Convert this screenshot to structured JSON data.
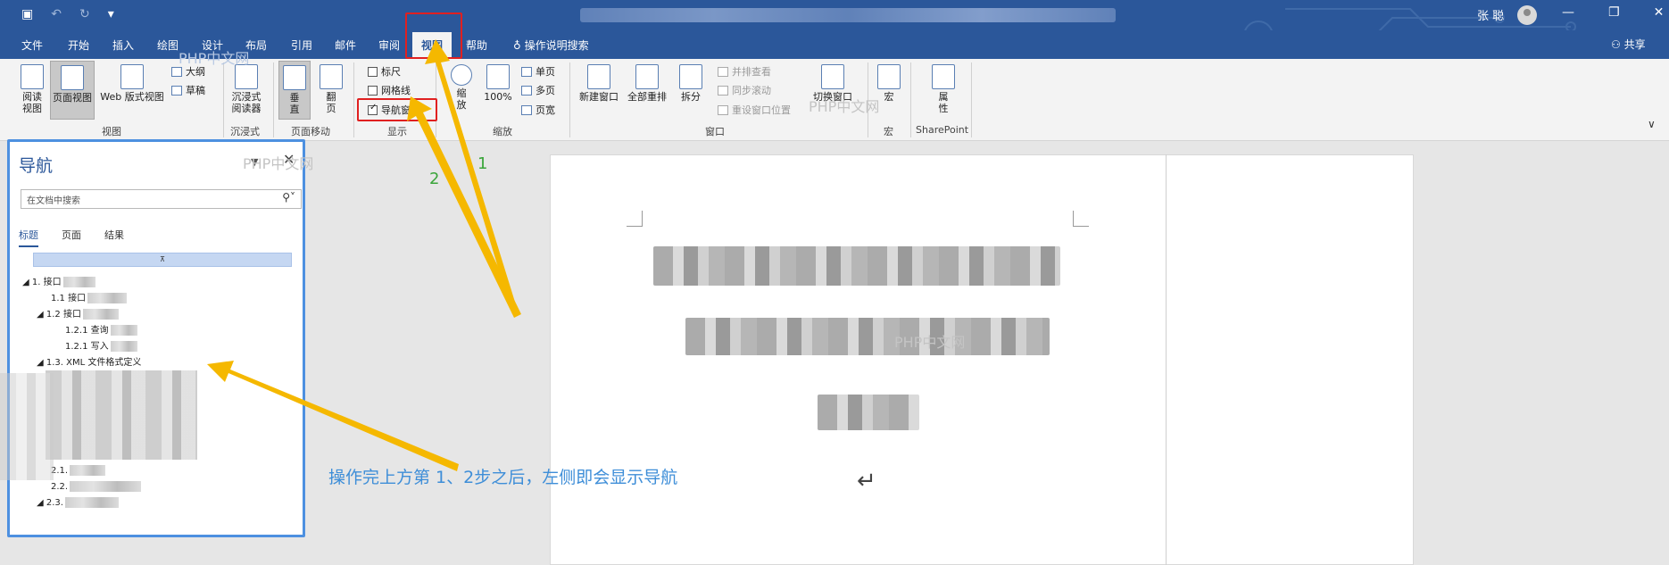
{
  "titlebar": {
    "qat_icons": [
      "save-icon",
      "undo-icon",
      "redo-icon",
      "customize-icon"
    ],
    "user_name": "张 聪",
    "window_buttons": [
      "—",
      "❐",
      "✕"
    ]
  },
  "tabs": [
    {
      "label": "文件"
    },
    {
      "label": "开始"
    },
    {
      "label": "插入"
    },
    {
      "label": "绘图"
    },
    {
      "label": "设计"
    },
    {
      "label": "布局"
    },
    {
      "label": "引用"
    },
    {
      "label": "邮件"
    },
    {
      "label": "审阅"
    },
    {
      "label": "视图"
    },
    {
      "label": "帮助"
    }
  ],
  "tell_me": "操作说明搜索",
  "share": "共享",
  "ribbon": {
    "views": {
      "read": "阅读视图",
      "print": "页面视图",
      "web": "Web 版式视图",
      "outline": "大纲",
      "draft": "草稿",
      "group": "视图"
    },
    "immersive": {
      "reader": "沉浸式阅读器",
      "group": "沉浸式"
    },
    "page_move": {
      "vertical": "垂直",
      "side": "翻页",
      "group": "页面移动"
    },
    "show": {
      "ruler": "标尺",
      "gridlines": "网格线",
      "nav_pane": "导航窗格",
      "group": "显示"
    },
    "zoom": {
      "zoom": "缩放",
      "hundred": "100%",
      "one_page": "单页",
      "multi_page": "多页",
      "page_width": "页宽",
      "group": "缩放"
    },
    "window": {
      "new_window": "新建窗口",
      "arrange_all": "全部重排",
      "split": "拆分",
      "side_by_side": "并排查看",
      "sync_scroll": "同步滚动",
      "reset_pos": "重设窗口位置",
      "switch": "切换窗口",
      "group": "窗口"
    },
    "macros": {
      "macro": "宏",
      "group": "宏"
    },
    "sharepoint": {
      "properties": "属性",
      "group": "SharePoint"
    }
  },
  "nav_pane": {
    "title": "导航",
    "search_placeholder": "在文档中搜索",
    "tabs": [
      "标题",
      "页面",
      "结果"
    ],
    "items": [
      "1. 接口",
      "1.1 接口",
      "1.2 接口",
      "1.2.1 查询",
      "1.2.1 写入",
      "1.3. XML 文件格式定义",
      "2.1.",
      "2.2.",
      "2.3."
    ]
  },
  "annotations": {
    "step1": "1",
    "step2": "2",
    "caption": "操作完上方第 1、2步之后，左侧即会显示导航"
  },
  "watermark": "PHP中文网",
  "colors": {
    "word_blue": "#2b579a",
    "highlight_red": "#e02020",
    "arrow_yellow": "#f5b800",
    "nav_border": "#4d90e0",
    "caption_blue": "#3e8ed8"
  }
}
